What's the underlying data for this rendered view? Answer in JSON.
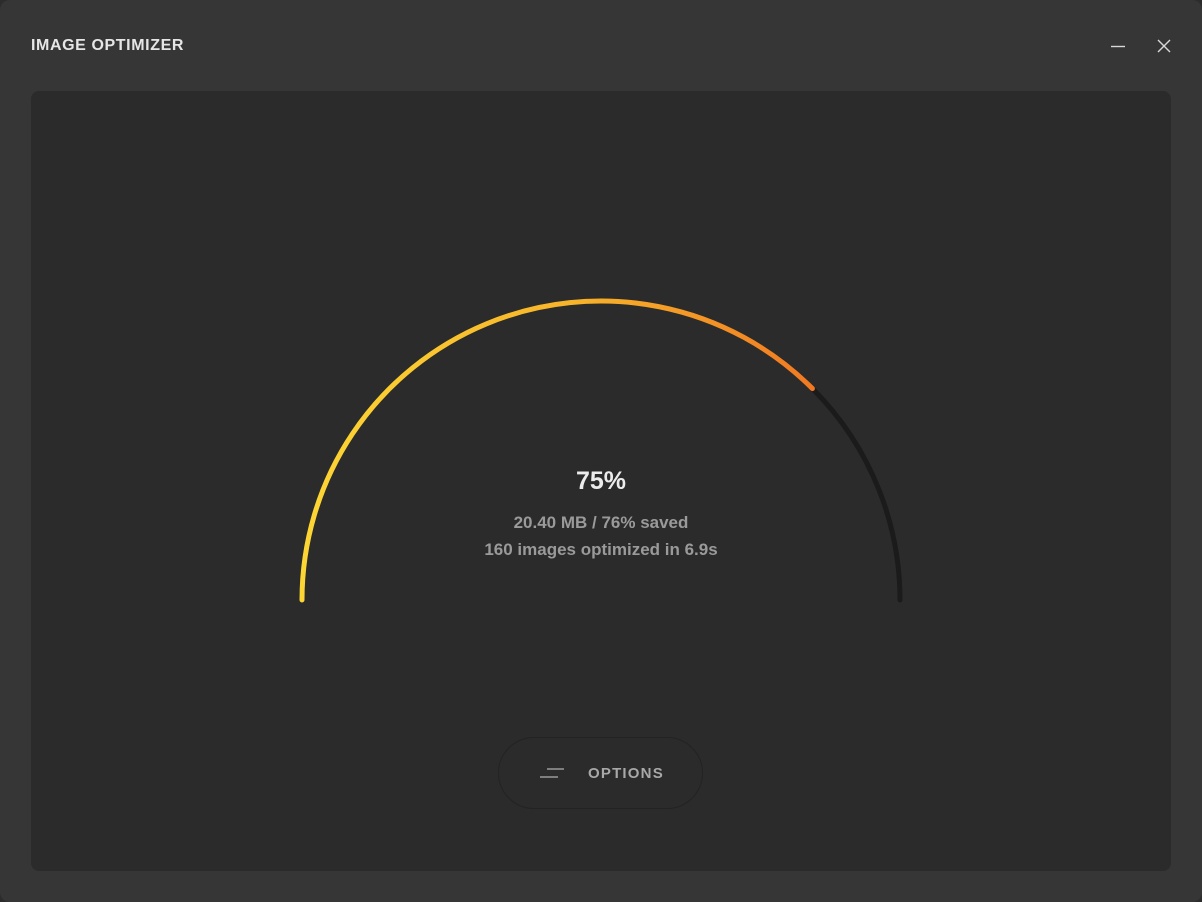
{
  "window": {
    "title": "IMAGE OPTIMIZER",
    "minimize_icon": "minimize-icon",
    "close_icon": "close-icon"
  },
  "progress": {
    "percent_label": "75%",
    "value": 0.75,
    "saved_line": "20.40 MB / 76% saved",
    "summary_line": "160 images optimized in 6.9s",
    "colors": {
      "start": "#fcd635",
      "mid": "#f7b22a",
      "end": "#f07a23",
      "track": "#1b1b1b"
    }
  },
  "options": {
    "label": "OPTIONS",
    "icon": "sliders-lines-icon"
  }
}
